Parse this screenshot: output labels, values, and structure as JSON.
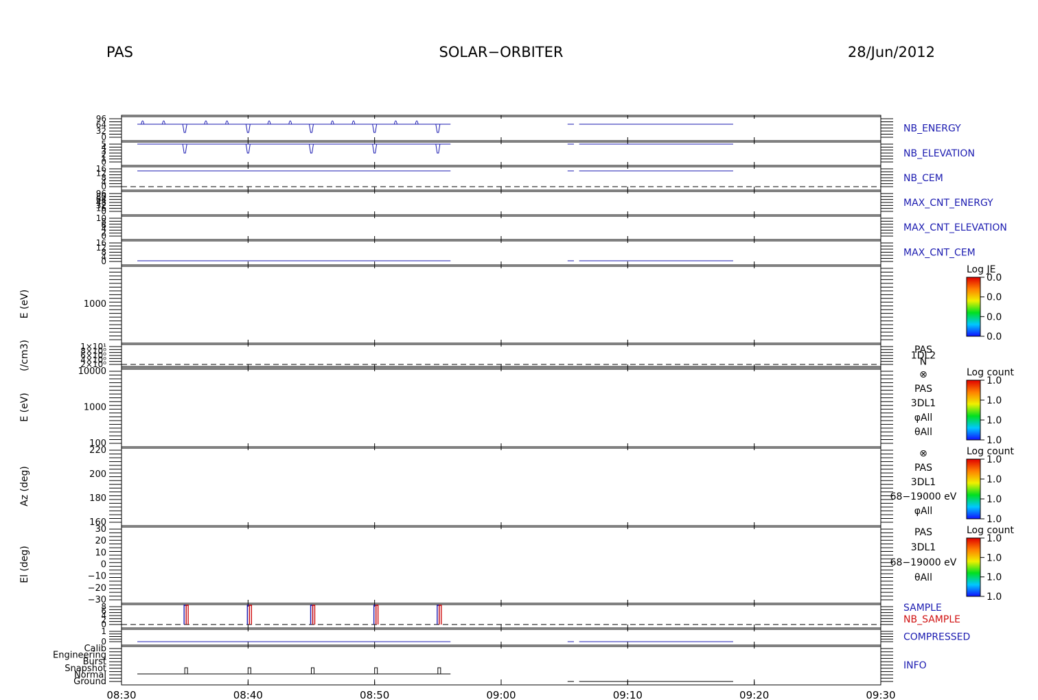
{
  "header": {
    "instrument": "PAS",
    "mission": "SOLAR−ORBITER",
    "date": "28/Jun/2012"
  },
  "colors": {
    "blue": "#1a1ab0",
    "red": "#d01010",
    "black": "#000000"
  },
  "chart_data": {
    "type": "line",
    "x_axis": {
      "range": [
        "08:30",
        "09:30"
      ],
      "ticks": [
        "08:30",
        "08:40",
        "08:50",
        "09:00",
        "09:10",
        "09:20",
        "09:30"
      ]
    },
    "panels": [
      {
        "label": "NB_ENERGY",
        "ticks": [
          "96",
          "64",
          "32",
          "0"
        ],
        "series": [
          {
            "segments": [
              [
                "08:31:15",
                "08:56:00"
              ],
              [
                "09:05:15",
                "09:05:45"
              ],
              [
                "09:06:10",
                "09:18:20"
              ]
            ],
            "pulses": [
              "08:31:40",
              "08:33:20",
              "08:36:40",
              "08:38:20",
              "08:41:40",
              "08:43:20",
              "08:46:40",
              "08:48:20",
              "08:51:40",
              "08:53:20"
            ],
            "dips": [
              "08:35:00",
              "08:40:00",
              "08:45:00",
              "08:50:00",
              "08:55:00"
            ]
          }
        ]
      },
      {
        "label": "NB_ELEVATION",
        "ticks": [
          "5",
          "4",
          "3",
          "2",
          "1",
          "0"
        ],
        "series": [
          {
            "segments": [
              [
                "08:31:15",
                "08:56:00"
              ],
              [
                "09:05:15",
                "09:05:45"
              ],
              [
                "09:06:10",
                "09:18:20"
              ]
            ],
            "dips": [
              "08:35:00",
              "08:40:00",
              "08:45:00",
              "08:50:00",
              "08:55:00"
            ]
          }
        ]
      },
      {
        "label": "NB_CEM",
        "ticks": [
          "16",
          "12",
          "8",
          "4",
          "0"
        ],
        "series": [
          {
            "segments": [
              [
                "08:31:15",
                "08:56:00"
              ],
              [
                "09:05:15",
                "09:05:45"
              ],
              [
                "09:06:10",
                "09:18:20"
              ]
            ]
          }
        ]
      },
      {
        "label": "MAX_CNT_ENERGY",
        "ticks": [
          "96",
          "80",
          "64",
          "48",
          "32",
          "16",
          "0"
        ]
      },
      {
        "label": "MAX_CNT_ELEVATION",
        "ticks": [
          "10",
          "8",
          "6",
          "4",
          "2",
          "0"
        ]
      },
      {
        "label": "MAX_CNT_CEM",
        "ticks": [
          "16",
          "12",
          "8",
          "4",
          "0"
        ],
        "series": [
          {
            "segments": [
              [
                "08:31:15",
                "08:56:00"
              ],
              [
                "09:05:15",
                "09:05:45"
              ],
              [
                "09:06:10",
                "09:18:20"
              ]
            ]
          }
        ]
      },
      {
        "ylabel": "E (eV)",
        "ticks": [
          "1000"
        ],
        "side_label": [
          "",
          ""
        ],
        "colorbar": {
          "title": "Log JE",
          "ticks": [
            "0.0",
            "0.0",
            "0.0",
            "0.0"
          ]
        }
      },
      {
        "ylabel": "(/cm3)",
        "ticks": [
          "1×10¹",
          "8×10⁰",
          "6×10⁰",
          "4×10⁰",
          "2×10⁰"
        ],
        "side_label": [
          "PAS",
          "1DL2",
          "N"
        ]
      },
      {
        "ylabel": "E (eV)",
        "ticks": [
          "10000",
          "1000",
          "100"
        ],
        "side_label": [
          "⊗",
          "PAS",
          "3DL1",
          "φAll",
          "θAll"
        ],
        "colorbar": {
          "title": "Log count",
          "ticks": [
            "1.0",
            "1.0",
            "1.0",
            "1.0"
          ]
        }
      },
      {
        "ylabel": "Az (deg)",
        "ticks": [
          "220",
          "200",
          "180",
          "160"
        ],
        "side_label": [
          "⊗",
          "PAS",
          "3DL1",
          "68−19000 eV",
          "φAll"
        ],
        "colorbar": {
          "title": "Log count",
          "ticks": [
            "1.0",
            "1.0",
            "1.0",
            "1.0"
          ]
        }
      },
      {
        "ylabel": "El (deg)",
        "ticks": [
          "30",
          "20",
          "10",
          "0",
          "−10",
          "−20",
          "−30"
        ],
        "side_label": [
          "PAS",
          "3DL1",
          "68−19000 eV",
          "θAll"
        ],
        "colorbar": {
          "title": "Log count",
          "ticks": [
            "1.0",
            "1.0",
            "1.0",
            "1.0"
          ]
        }
      },
      {
        "label": "SAMPLE",
        "label2": "NB_SAMPLE",
        "ticks": [
          "8",
          "6",
          "4",
          "2",
          "0"
        ],
        "series": [
          {
            "name": "SAMPLE",
            "pulses": [
              "08:35:00",
              "08:40:00",
              "08:45:00",
              "08:50:00",
              "08:55:00"
            ]
          },
          {
            "name": "NB_SAMPLE",
            "pulses": [
              "08:35:00",
              "08:40:00",
              "08:45:00",
              "08:50:00",
              "08:55:00"
            ]
          }
        ]
      },
      {
        "label": "COMPRESSED",
        "ticks": [
          "1",
          "0"
        ],
        "series": [
          {
            "segments": [
              [
                "08:31:15",
                "08:56:00"
              ],
              [
                "09:05:15",
                "09:05:45"
              ],
              [
                "09:06:10",
                "09:18:20"
              ]
            ]
          }
        ]
      },
      {
        "label": "INFO",
        "ticks": [
          "Calib",
          "Engineering",
          "Burst",
          "Snapshot",
          "Normal",
          "Ground"
        ],
        "series": [
          {
            "segments": [
              [
                "08:31:15",
                "08:56:00"
              ],
              [
                "09:05:15",
                "09:05:45"
              ],
              [
                "09:06:10",
                "09:18:20"
              ]
            ],
            "pulses": [
              "08:35:00",
              "08:40:00",
              "08:45:00",
              "08:50:00",
              "08:55:00"
            ]
          }
        ]
      }
    ]
  }
}
